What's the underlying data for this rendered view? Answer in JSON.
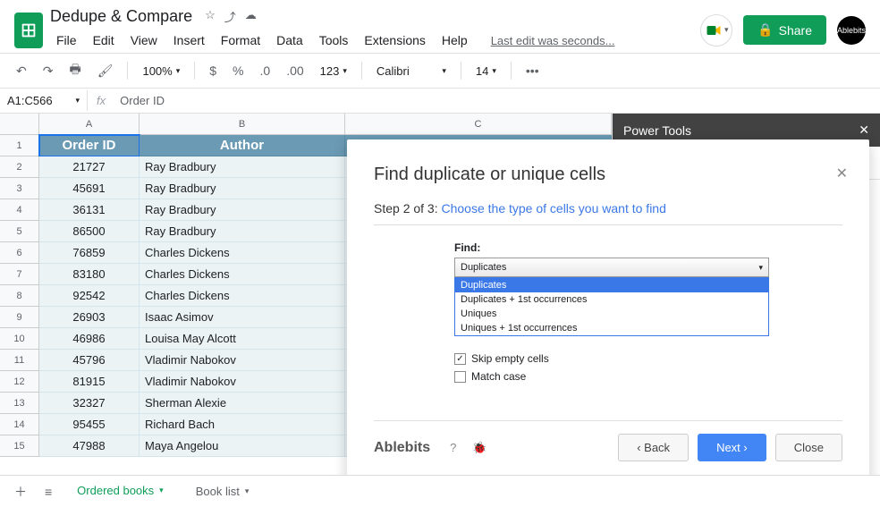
{
  "doc": {
    "title": "Dedupe & Compare",
    "last_edit": "Last edit was seconds..."
  },
  "menu": {
    "file": "File",
    "edit": "Edit",
    "view": "View",
    "insert": "Insert",
    "format": "Format",
    "data": "Data",
    "tools": "Tools",
    "extensions": "Extensions",
    "help": "Help"
  },
  "share": {
    "label": "Share"
  },
  "avatar": {
    "label": "Ablebits"
  },
  "toolbar": {
    "zoom": "100%",
    "currency": "$",
    "percent": "%",
    "dec_dec": ".0",
    "dec_inc": ".00",
    "num_format": "123",
    "font": "Calibri",
    "font_size": "14",
    "more": "•••"
  },
  "namebox": {
    "ref": "A1:C566",
    "formula": "Order ID"
  },
  "columns": {
    "a": "A",
    "b": "B",
    "c": "C"
  },
  "headers": {
    "order_id": "Order ID",
    "author": "Author"
  },
  "rows": [
    {
      "n": "1"
    },
    {
      "n": "2",
      "id": "21727",
      "author": "Ray Bradbury"
    },
    {
      "n": "3",
      "id": "45691",
      "author": "Ray Bradbury"
    },
    {
      "n": "4",
      "id": "36131",
      "author": "Ray Bradbury"
    },
    {
      "n": "5",
      "id": "86500",
      "author": "Ray Bradbury"
    },
    {
      "n": "6",
      "id": "76859",
      "author": "Charles Dickens"
    },
    {
      "n": "7",
      "id": "83180",
      "author": "Charles Dickens"
    },
    {
      "n": "8",
      "id": "92542",
      "author": "Charles Dickens"
    },
    {
      "n": "9",
      "id": "26903",
      "author": "Isaac Asimov"
    },
    {
      "n": "10",
      "id": "46986",
      "author": "Louisa May Alcott"
    },
    {
      "n": "11",
      "id": "45796",
      "author": "Vladimir Nabokov"
    },
    {
      "n": "12",
      "id": "81915",
      "author": "Vladimir Nabokov"
    },
    {
      "n": "13",
      "id": "32327",
      "author": "Sherman Alexie"
    },
    {
      "n": "14",
      "id": "95455",
      "author": "Richard Bach"
    },
    {
      "n": "15",
      "id": "47988",
      "author": "Maya Angelou"
    }
  ],
  "side": {
    "title": "Power Tools"
  },
  "modal": {
    "title": "Find duplicate or unique cells",
    "step_prefix": "Step 2 of 3: ",
    "step_link": "Choose the type of cells you want to find",
    "find_label": "Find:",
    "selected": "Duplicates",
    "options": [
      "Duplicates",
      "Duplicates + 1st occurrences",
      "Uniques",
      "Uniques + 1st occurrences"
    ],
    "skip_empty": "Skip empty cells",
    "match_case": "Match case",
    "brand": "Ablebits",
    "back": "Back",
    "next": "Next",
    "close": "Close"
  },
  "tabs": {
    "t1": "Ordered books",
    "t2": "Book list"
  }
}
